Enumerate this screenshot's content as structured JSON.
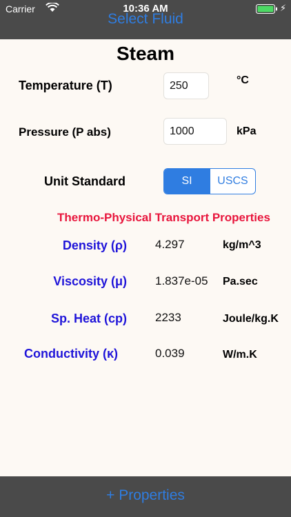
{
  "status_bar": {
    "carrier": "Carrier",
    "time": "10:36 AM"
  },
  "nav": {
    "select_fluid": "Select Fluid"
  },
  "title": "Steam",
  "inputs": {
    "temperature_label": "Temperature (T)",
    "temperature_value": "250",
    "temperature_unit": "°C",
    "pressure_label": "Pressure (P abs)",
    "pressure_value": "1000",
    "pressure_unit": "kPa"
  },
  "unit_standard": {
    "label": "Unit Standard",
    "options": [
      "SI",
      "USCS"
    ],
    "selected": "SI"
  },
  "section_title": "Thermo-Physical Transport Properties",
  "properties": [
    {
      "label": "Density (ρ)",
      "value": "4.297",
      "unit": "kg/m^3"
    },
    {
      "label": "Viscosity (μ)",
      "value": "1.837e-05",
      "unit": "Pa.sec"
    },
    {
      "label": "Sp. Heat (cp)",
      "value": "2233",
      "unit": "Joule/kg.K"
    },
    {
      "label": "Conductivity (κ)",
      "value": "0.039",
      "unit": "W/m.K"
    }
  ],
  "bottom": {
    "properties_button": "+ Properties"
  },
  "colors": {
    "accent_blue": "#2f7de1",
    "label_blue": "#1f14d9",
    "section_red": "#e8153c",
    "bar_gray": "#4a4a4a"
  }
}
